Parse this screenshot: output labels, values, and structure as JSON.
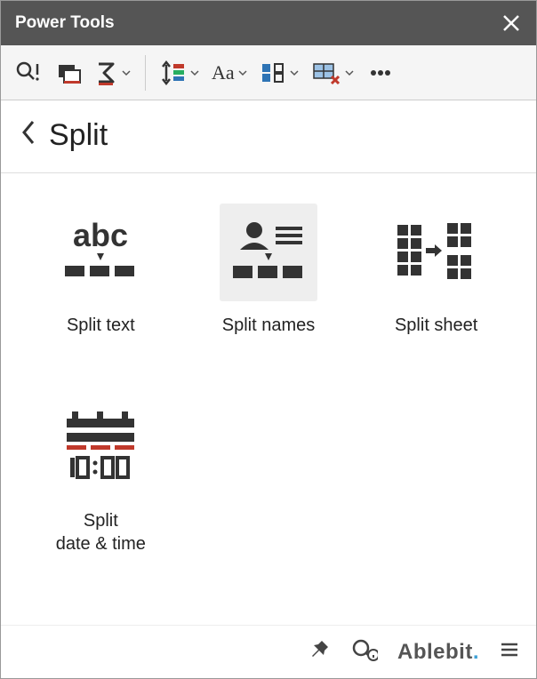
{
  "titlebar": {
    "title": "Power Tools"
  },
  "header": {
    "page_title": "Split"
  },
  "tiles": [
    {
      "label": "Split text"
    },
    {
      "label": "Split names"
    },
    {
      "label": "Split sheet"
    },
    {
      "label": "Split\ndate & time"
    }
  ],
  "footer": {
    "brand": "Ablebits"
  }
}
